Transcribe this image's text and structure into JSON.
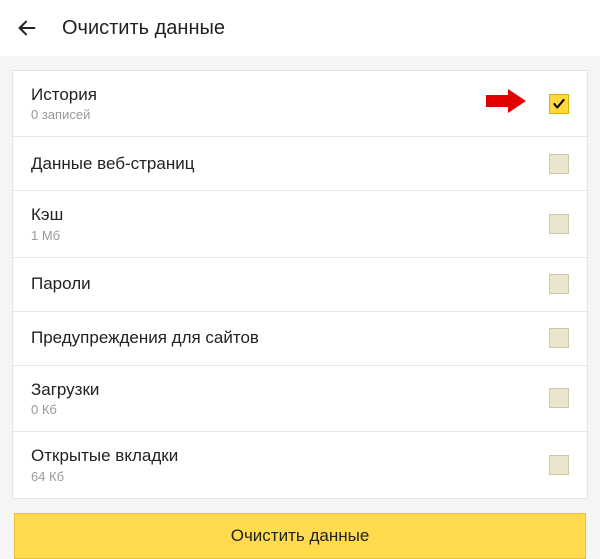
{
  "header": {
    "title": "Очистить данные"
  },
  "items": [
    {
      "title": "История",
      "sub": "0 записей",
      "checked": true
    },
    {
      "title": "Данные веб-страниц",
      "sub": "",
      "checked": false
    },
    {
      "title": "Кэш",
      "sub": "1 Мб",
      "checked": false
    },
    {
      "title": "Пароли",
      "sub": "",
      "checked": false
    },
    {
      "title": "Предупреждения для сайтов",
      "sub": "",
      "checked": false
    },
    {
      "title": "Загрузки",
      "sub": "0 Кб",
      "checked": false
    },
    {
      "title": "Открытые вкладки",
      "sub": "64 Кб",
      "checked": false
    }
  ],
  "clear_button_label": "Очистить данные",
  "annotation": {
    "arrow_points_to_item": 0
  }
}
